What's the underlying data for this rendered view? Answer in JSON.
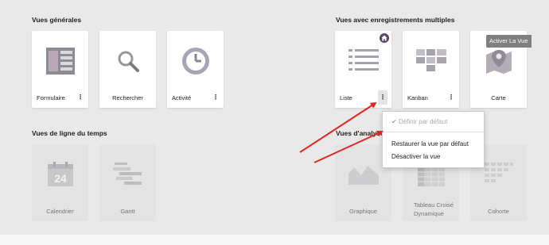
{
  "sections": {
    "general": "Vues générales",
    "multi": "Vues avec enregistrements multiples",
    "timeline": "Vues de ligne du temps",
    "analysis": "Vues d'analyse"
  },
  "cards": {
    "formulaire": "Formulaire",
    "rechercher": "Rechercher",
    "activite": "Activité",
    "liste": "Liste",
    "kanban": "Kanban",
    "carte": "Carte",
    "calendrier": "Calendrier",
    "gantt": "Gantt",
    "graphique": "Graphique",
    "pivot": "Tableau Croisé Dynamique",
    "cohorte": "Cohorte"
  },
  "kebab_glyph": "⋮",
  "tooltip": "Activer La Vue",
  "calendar_day": "24",
  "dropdown": {
    "set_default": "Définir par défaut",
    "restore_default": "Restaurer la vue par défaut",
    "deactivate": "Désactiver la vue"
  },
  "colors": {
    "background": "#e9e9e9",
    "card": "#ffffff",
    "card_disabled": "#e3e3e3",
    "badge": "#5c4270",
    "arrow": "#e02424",
    "tooltip": "#7f7f7f"
  },
  "icons": {
    "home": "home-icon",
    "check": "check-icon",
    "kebab": "kebab-icon"
  }
}
